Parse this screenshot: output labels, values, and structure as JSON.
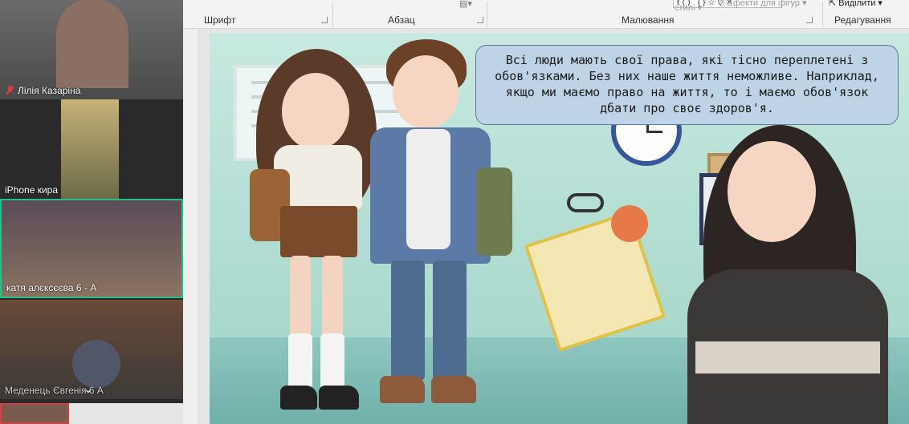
{
  "ribbon": {
    "font_group": "Шрифт",
    "paragraph_group": "Абзац",
    "drawing_group": "Малювання",
    "editing_group": "Редагування",
    "styles_label": "стилі",
    "effects_label": "Ефекти для фігур",
    "select_label": "Виділити",
    "shape_gallery": "ℓ⟨⟩ {}☆▽✕"
  },
  "participants": [
    {
      "name": "Лілія Казаріна",
      "muted": true
    },
    {
      "name": "iPhone кира",
      "muted": false
    },
    {
      "name": "катя алєксєєва 6 - А",
      "muted": false,
      "active": true
    },
    {
      "name": "Меденець Євгенія 6 А",
      "muted": false
    }
  ],
  "slide": {
    "speech_text": "Всі люди мають свої права, які тісно переплетені з обов'язками. Без них наше життя неможливе. Наприклад, якщо ми маємо право на життя, то і маємо обов'язок дбати про своє здоров'я."
  },
  "colors": {
    "active_border": "#28c08a",
    "speech_bg": "#bfd3e6",
    "mic_off": "#e23b3b"
  }
}
